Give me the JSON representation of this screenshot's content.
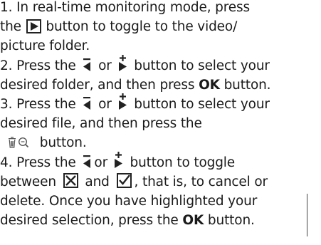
{
  "steps": [
    {
      "line1_a": "1. In real-time monitoring mode, press",
      "line2_a": "the",
      "line2_b": "button to toggle to the video/",
      "line3": "picture folder."
    },
    {
      "line1_a": "2. Press the",
      "line1_b": "or",
      "line1_c": "button to select your",
      "line2_a": "desired folder, and then press",
      "line2_bold": "OK",
      "line2_b": "button."
    },
    {
      "line1_a": "3. Press the",
      "line1_b": "or",
      "line1_c": "button to select your",
      "line2": "desired file, and then press the",
      "line3_b": "button."
    },
    {
      "line1_a": "4. Press the",
      "line1_b": "or",
      "line1_c": "button to toggle",
      "line2_a": "between",
      "line2_b": "and",
      "line2_c": ", that is, to cancel or",
      "line3": "delete.  Once you have highlighted your",
      "line4_a": "desired selection, press the",
      "line4_bold": "OK",
      "line4_b": "button."
    }
  ],
  "icons": {
    "play": "play-button-icon",
    "prev": "prev-minus-button-icon",
    "next": "next-plus-button-icon",
    "delete": "delete-zoom-button-icon",
    "cancel": "cancel-box-icon",
    "confirm": "confirm-checkbox-icon"
  },
  "colors": {
    "text": "#1a1a1a",
    "icon": "#222222"
  }
}
